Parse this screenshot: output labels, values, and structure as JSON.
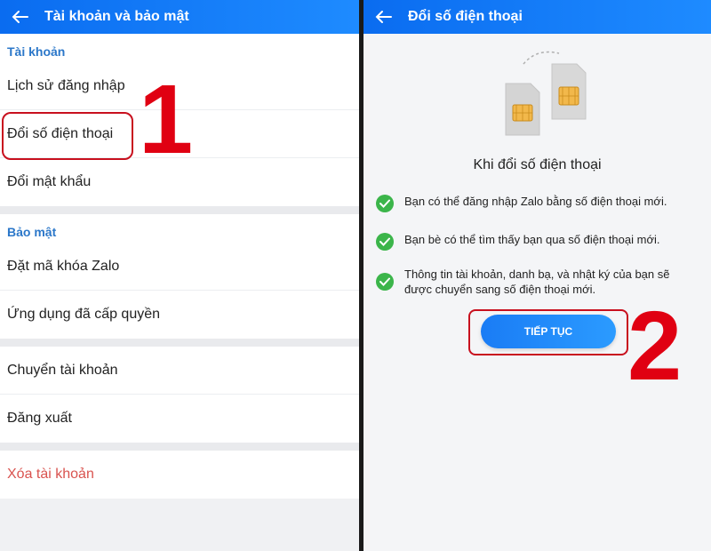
{
  "left": {
    "header_title": "Tài khoản và bảo mật",
    "section_account": "Tài khoản",
    "account_items": [
      "Lịch sử đăng nhập",
      "Đổi số điện thoại",
      "Đổi mật khẩu"
    ],
    "section_security": "Bảo mật",
    "security_items": [
      "Đặt mã khóa Zalo",
      "Ứng dụng đã cấp quyền"
    ],
    "other_items": [
      "Chuyển tài khoản",
      "Đăng xuất"
    ],
    "delete_item": "Xóa tài khoản",
    "step_marker": "1"
  },
  "right": {
    "header_title": "Đổi số điện thoại",
    "intro_title": "Khi đổi số điện thoại",
    "benefits": [
      "Bạn có thể đăng nhập Zalo bằng số điện thoại mới.",
      "Bạn bè có thể tìm thấy bạn qua số điện thoại mới.",
      "Thông tin tài khoản, danh bạ, và nhật ký của bạn sẽ được chuyển sang số điện thoại mới."
    ],
    "continue_label": "TIẾP TỤC",
    "step_marker": "2"
  },
  "colors": {
    "header": "#0a6cf0",
    "section_label": "#2b77c9",
    "danger": "#d9534f",
    "highlight": "#c8101e",
    "check": "#3bb54a"
  }
}
